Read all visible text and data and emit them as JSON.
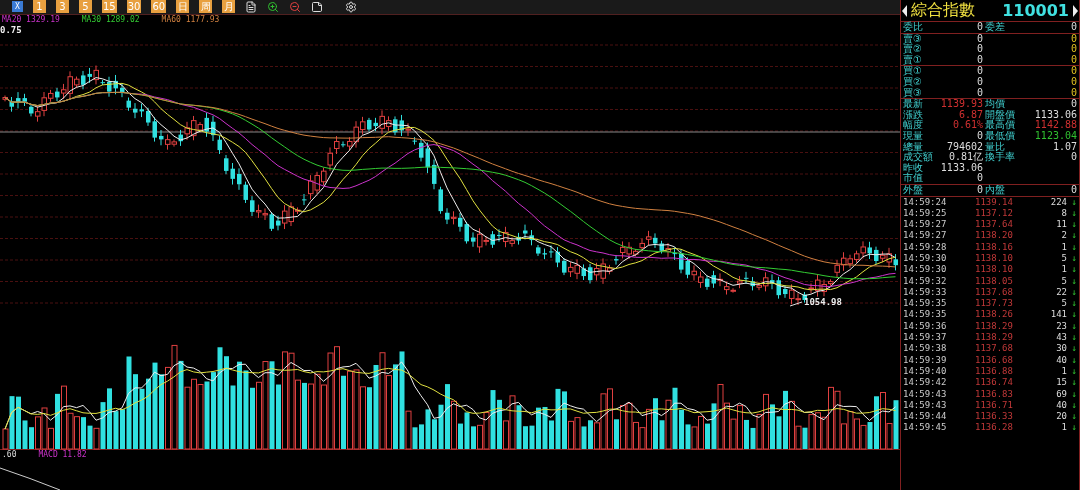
{
  "toolbar": {
    "close_label": "X",
    "period_buttons": [
      "1",
      "3",
      "5",
      "15",
      "30",
      "60",
      "日",
      "周",
      "月"
    ]
  },
  "legend": [
    "MA20 1329.19",
    "MA30 1289.02",
    "MA60 1177.93"
  ],
  "price_marker": "0.75",
  "low_label": "1054.98",
  "bottom_legend": [
    ".60",
    "MACD 11.82"
  ],
  "quote": {
    "name": "綜合指數",
    "code": "110001",
    "sections": [
      {
        "kind": "pair",
        "rows": [
          {
            "label": "委比",
            "value": "0",
            "rising": false,
            "falling": false,
            "label2": "委差",
            "value2": "0",
            "rising2": false,
            "falling2": false
          }
        ]
      },
      {
        "kind": "book",
        "rows": [
          {
            "label": "賣③",
            "value": "0",
            "value2": "0"
          },
          {
            "label": "賣②",
            "value": "0",
            "value2": "0"
          },
          {
            "label": "賣①",
            "value": "0",
            "value2": "0"
          }
        ]
      },
      {
        "kind": "book",
        "rows": [
          {
            "label": "買①",
            "value": "0",
            "value2": "0"
          },
          {
            "label": "買②",
            "value": "0",
            "value2": "0"
          },
          {
            "label": "買③",
            "value": "0",
            "value2": "0"
          }
        ]
      },
      {
        "kind": "pair",
        "rows": [
          {
            "label": "最新",
            "value": "1139.93",
            "rising": true,
            "falling": false,
            "label2": "均價",
            "value2": "0",
            "rising2": false,
            "falling2": false
          },
          {
            "label": "漲跌",
            "value": "6.87",
            "rising": true,
            "falling": false,
            "label2": "開盤價",
            "value2": "1133.06",
            "rising2": false,
            "falling2": false
          },
          {
            "label": "幅度",
            "value": "0.61%",
            "rising": true,
            "falling": false,
            "label2": "最高價",
            "value2": "1142.88",
            "rising2": true,
            "falling2": false
          },
          {
            "label": "現量",
            "value": "0",
            "rising": false,
            "falling": false,
            "label2": "最低價",
            "value2": "1123.04",
            "rising2": false,
            "falling2": true
          },
          {
            "label": "總量",
            "value": "794602",
            "rising": false,
            "falling": false,
            "label2": "量比",
            "value2": "1.07",
            "rising2": false,
            "falling2": false
          },
          {
            "label": "成交額",
            "value": "0.81亿",
            "rising": false,
            "falling": false,
            "label2": "換手率",
            "value2": "0",
            "rising2": false,
            "falling2": false
          },
          {
            "label": "昨收",
            "value": "1133.06",
            "rising": false,
            "falling": false
          },
          {
            "label": "市值",
            "value": "0",
            "rising": false,
            "falling": false
          }
        ]
      },
      {
        "kind": "pair",
        "rows": [
          {
            "label": "外盤",
            "value": "0",
            "rising": false,
            "falling": false,
            "label2": "內盤",
            "value2": "0",
            "rising2": false,
            "falling2": false
          }
        ]
      }
    ]
  },
  "ticks": [
    {
      "time": "14:59:24",
      "price": "1139.14",
      "volume": "224",
      "arrow": "↓"
    },
    {
      "time": "14:59:25",
      "price": "1137.12",
      "volume": "8",
      "arrow": "↓"
    },
    {
      "time": "14:59:27",
      "price": "1137.64",
      "volume": "11",
      "arrow": "↓"
    },
    {
      "time": "14:59:27",
      "price": "1138.20",
      "volume": "2",
      "arrow": "↓"
    },
    {
      "time": "14:59:28",
      "price": "1138.16",
      "volume": "1",
      "arrow": "↓"
    },
    {
      "time": "14:59:30",
      "price": "1138.10",
      "volume": "5",
      "arrow": "↓"
    },
    {
      "time": "14:59:30",
      "price": "1138.10",
      "volume": "1",
      "arrow": "↓"
    },
    {
      "time": "14:59:32",
      "price": "1138.05",
      "volume": "5",
      "arrow": "↓"
    },
    {
      "time": "14:59:33",
      "price": "1137.68",
      "volume": "22",
      "arrow": "↓"
    },
    {
      "time": "14:59:35",
      "price": "1137.73",
      "volume": "5",
      "arrow": "↓"
    },
    {
      "time": "14:59:35",
      "price": "1138.26",
      "volume": "141",
      "arrow": "↓"
    },
    {
      "time": "14:59:36",
      "price": "1138.29",
      "volume": "23",
      "arrow": "↓"
    },
    {
      "time": "14:59:37",
      "price": "1138.29",
      "volume": "43",
      "arrow": "↓"
    },
    {
      "time": "14:59:38",
      "price": "1137.68",
      "volume": "30",
      "arrow": "↓"
    },
    {
      "time": "14:59:39",
      "price": "1136.68",
      "volume": "40",
      "arrow": "↓"
    },
    {
      "time": "14:59:40",
      "price": "1136.88",
      "volume": "1",
      "arrow": "↓"
    },
    {
      "time": "14:59:42",
      "price": "1136.74",
      "volume": "15",
      "arrow": "↓"
    },
    {
      "time": "14:59:43",
      "price": "1136.83",
      "volume": "69",
      "arrow": "↓"
    },
    {
      "time": "14:59:43",
      "price": "1136.71",
      "volume": "40",
      "arrow": "↓"
    },
    {
      "time": "14:59:44",
      "price": "1136.33",
      "volume": "20",
      "arrow": "↓"
    },
    {
      "time": "14:59:45",
      "price": "1136.28",
      "volume": "1",
      "arrow": "↓"
    }
  ]
}
